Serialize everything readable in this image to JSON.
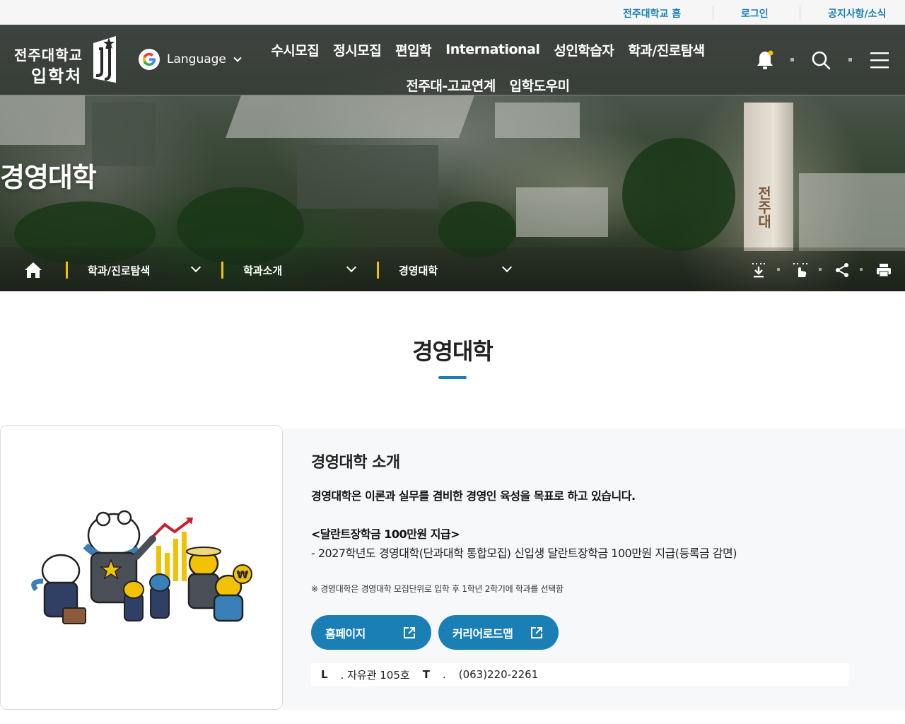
{
  "utility_links": [
    {
      "label": "전주대학교 홈"
    },
    {
      "label": "로그인"
    },
    {
      "label": "공지사항/소식"
    }
  ],
  "logo": {
    "line1": "전주대학교",
    "line2": "입학처"
  },
  "language": {
    "label": "Language"
  },
  "main_nav": {
    "row1": [
      "수시모집",
      "정시모집",
      "편입학",
      "International",
      "성인학습자",
      "학과/진로탐색"
    ],
    "row2": [
      "전주대-고교연계",
      "입학도우미"
    ]
  },
  "header_icons": [
    "bell-icon",
    "search-icon",
    "menu-icon"
  ],
  "hero": {
    "title": "경영대학",
    "tower_text": "전주대"
  },
  "breadcrumb": {
    "items": [
      {
        "label": "학과/진로탐색"
      },
      {
        "label": "학과소개"
      },
      {
        "label": "경영대학"
      }
    ],
    "tools": [
      "download-icon",
      "pointer-icon",
      "share-icon",
      "print-icon"
    ]
  },
  "page": {
    "heading": "경영대학"
  },
  "info": {
    "title": "경영대학 소개",
    "lead": "경영대학은 이론과 실무를 겸비한 경영인 육성을 목표로 하고 있습니다.",
    "sub_title": "<달란트장학금 100만원 지급>",
    "sub_body": "- 2027학년도 경영대학(단과대학 통합모집) 신입생 달란트장학금 100만원 지급(등록금 감면)",
    "note": "※ 경영대학은 경영대학 모집단위로 입학 후 1학년 2학기에 학과를 선택함",
    "buttons": [
      {
        "label": "홈페이지"
      },
      {
        "label": "커리어로드맵"
      }
    ],
    "contact": {
      "location_label": "L",
      "location_value": ". 자유관 105호",
      "tel_label": "T",
      "tel_sep": ".",
      "tel_value": "(063)220-2261"
    }
  },
  "colors": {
    "accent": "#1a7fb5",
    "crumb_bar": "#f2c200",
    "panel_bg": "#f7f8f9"
  }
}
